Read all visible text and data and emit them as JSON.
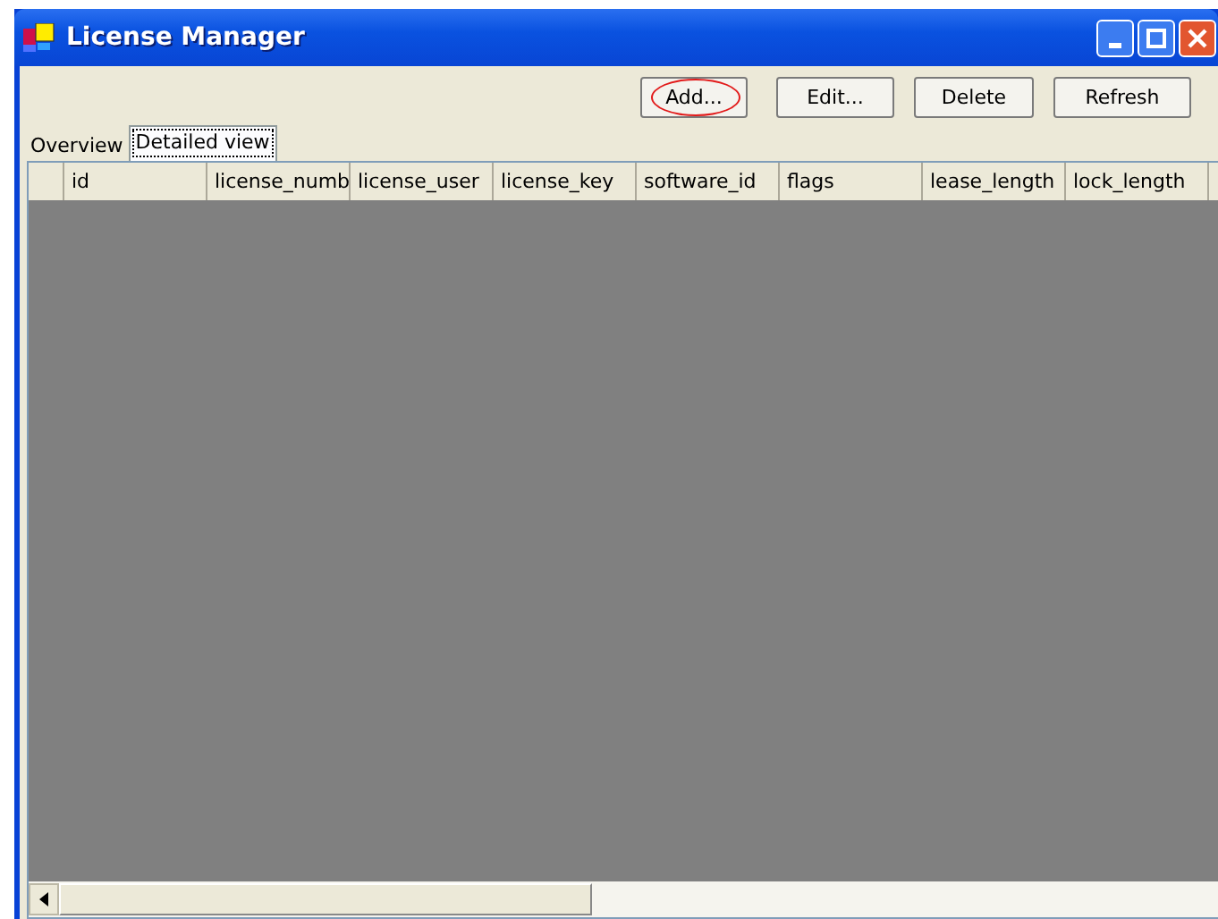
{
  "window": {
    "title": "License Manager"
  },
  "buttons": [
    {
      "label": "Add...",
      "highlighted": true
    },
    {
      "label": "Edit...",
      "highlighted": false
    },
    {
      "label": "Delete",
      "highlighted": false
    },
    {
      "label": "Refresh",
      "highlighted": false
    }
  ],
  "tabs": [
    {
      "label": "Overview",
      "selected": false
    },
    {
      "label": "Detailed view",
      "selected": true
    }
  ],
  "table": {
    "columns": [
      "id",
      "license_numb",
      "license_user",
      "license_key",
      "software_id",
      "flags",
      "lease_length",
      "lock_length"
    ]
  }
}
